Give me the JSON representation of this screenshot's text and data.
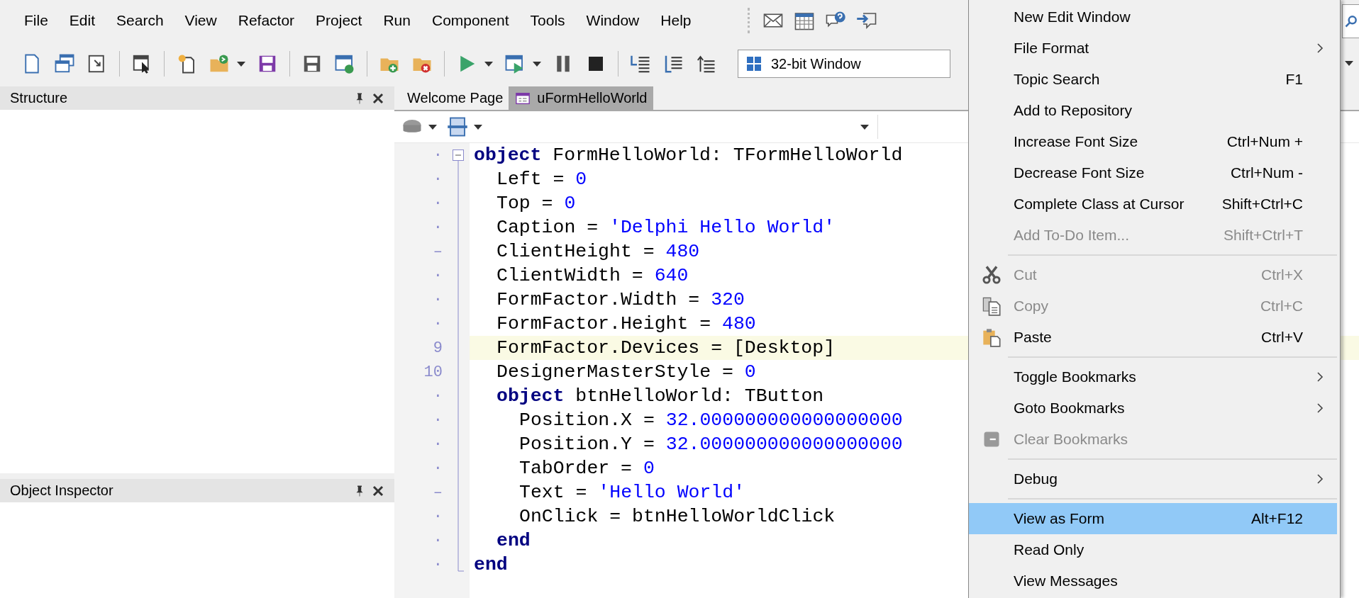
{
  "menu_bar": [
    "File",
    "Edit",
    "Search",
    "View",
    "Refactor",
    "Project",
    "Run",
    "Component",
    "Tools",
    "Window",
    "Help"
  ],
  "platform_combo": {
    "value": "32-bit Window"
  },
  "left_panels": [
    {
      "title": "Structure"
    },
    {
      "title": "Object Inspector"
    }
  ],
  "editor_tabs": [
    {
      "label": "Welcome Page",
      "selected": false
    },
    {
      "label": "uFormHelloWorld",
      "selected": true
    }
  ],
  "code_lines": [
    {
      "gutter": "·",
      "current": false,
      "tokens": [
        {
          "kind": "keyword",
          "t": "object"
        },
        {
          "kind": "plain",
          "t": " FormHelloWorld: TFormHelloWorld"
        }
      ],
      "children": [
        {
          "gutter": "·",
          "current": false,
          "tokens": [
            {
              "kind": "plain",
              "t": "Left = "
            },
            {
              "kind": "number",
              "t": "0"
            }
          ]
        },
        {
          "gutter": "·",
          "current": false,
          "tokens": [
            {
              "kind": "plain",
              "t": "Top = "
            },
            {
              "kind": "number",
              "t": "0"
            }
          ]
        },
        {
          "gutter": "·",
          "current": false,
          "tokens": [
            {
              "kind": "plain",
              "t": "Caption = "
            },
            {
              "kind": "string",
              "t": "'Delphi Hello World'"
            }
          ]
        },
        {
          "gutter": "–",
          "current": false,
          "tokens": [
            {
              "kind": "plain",
              "t": "ClientHeight = "
            },
            {
              "kind": "number",
              "t": "480"
            }
          ]
        },
        {
          "gutter": "·",
          "current": false,
          "tokens": [
            {
              "kind": "plain",
              "t": "ClientWidth = "
            },
            {
              "kind": "number",
              "t": "640"
            }
          ]
        },
        {
          "gutter": "·",
          "current": false,
          "tokens": [
            {
              "kind": "plain",
              "t": "FormFactor.Width = "
            },
            {
              "kind": "number",
              "t": "320"
            }
          ]
        },
        {
          "gutter": "·",
          "current": false,
          "tokens": [
            {
              "kind": "plain",
              "t": "FormFactor.Height = "
            },
            {
              "kind": "number",
              "t": "480"
            }
          ]
        },
        {
          "gutter": "9",
          "current": true,
          "tokens": [
            {
              "kind": "plain",
              "t": "FormFactor.Devices = [Desktop]"
            }
          ]
        },
        {
          "gutter": "10",
          "current": false,
          "tokens": [
            {
              "kind": "plain",
              "t": "DesignerMasterStyle = "
            },
            {
              "kind": "number",
              "t": "0"
            }
          ]
        },
        {
          "gutter": "·",
          "current": false,
          "tokens": [
            {
              "kind": "keyword",
              "t": "object"
            },
            {
              "kind": "plain",
              "t": " btnHelloWorld: TButton"
            }
          ],
          "children": [
            {
              "gutter": "·",
              "current": false,
              "tokens": [
                {
                  "kind": "plain",
                  "t": "Position.X = "
                },
                {
                  "kind": "number",
                  "t": "32.000000000000000000"
                }
              ]
            },
            {
              "gutter": "·",
              "current": false,
              "tokens": [
                {
                  "kind": "plain",
                  "t": "Position.Y = "
                },
                {
                  "kind": "number",
                  "t": "32.000000000000000000"
                }
              ]
            },
            {
              "gutter": "·",
              "current": false,
              "tokens": [
                {
                  "kind": "plain",
                  "t": "TabOrder = "
                },
                {
                  "kind": "number",
                  "t": "0"
                }
              ]
            },
            {
              "gutter": "–",
              "current": false,
              "tokens": [
                {
                  "kind": "plain",
                  "t": "Text = "
                },
                {
                  "kind": "string",
                  "t": "'Hello World'"
                }
              ]
            },
            {
              "gutter": "·",
              "current": false,
              "tokens": [
                {
                  "kind": "plain",
                  "t": "OnClick = btnHelloWorldClick"
                }
              ]
            }
          ]
        },
        {
          "gutter": "·",
          "current": false,
          "tokens": [
            {
              "kind": "keyword",
              "t": "end"
            }
          ]
        }
      ]
    },
    {
      "gutter": "·",
      "current": false,
      "tokens": [
        {
          "kind": "keyword",
          "t": "end"
        }
      ]
    }
  ],
  "context_menu": {
    "items": [
      {
        "kind": "item",
        "label": "New Edit Window",
        "disabled": false,
        "selected": false,
        "submenu": false
      },
      {
        "kind": "item",
        "label": "File Format",
        "disabled": false,
        "selected": false,
        "submenu": true
      },
      {
        "kind": "item",
        "label": "Topic Search",
        "shortcut": "F1",
        "disabled": false,
        "selected": false,
        "submenu": false
      },
      {
        "kind": "item",
        "label": "Add to Repository",
        "disabled": false,
        "selected": false,
        "submenu": false
      },
      {
        "kind": "item",
        "label": "Increase Font Size",
        "shortcut": "Ctrl+Num +",
        "disabled": false,
        "selected": false,
        "submenu": false
      },
      {
        "kind": "item",
        "label": "Decrease Font Size",
        "shortcut": "Ctrl+Num -",
        "disabled": false,
        "selected": false,
        "submenu": false
      },
      {
        "kind": "item",
        "label": "Complete Class at Cursor",
        "shortcut": "Shift+Ctrl+C",
        "disabled": false,
        "selected": false,
        "submenu": false
      },
      {
        "kind": "item",
        "label": "Add To-Do Item...",
        "shortcut": "Shift+Ctrl+T",
        "disabled": true,
        "selected": false,
        "submenu": false
      },
      {
        "kind": "separator"
      },
      {
        "kind": "item",
        "label": "Cut",
        "shortcut": "Ctrl+X",
        "disabled": true,
        "selected": false,
        "submenu": false
      },
      {
        "kind": "item",
        "label": "Copy",
        "shortcut": "Ctrl+C",
        "disabled": true,
        "selected": false,
        "submenu": false
      },
      {
        "kind": "item",
        "label": "Paste",
        "shortcut": "Ctrl+V",
        "disabled": false,
        "selected": false,
        "submenu": false
      },
      {
        "kind": "separator"
      },
      {
        "kind": "item",
        "label": "Toggle Bookmarks",
        "disabled": false,
        "selected": false,
        "submenu": true
      },
      {
        "kind": "item",
        "label": "Goto Bookmarks",
        "disabled": false,
        "selected": false,
        "submenu": true
      },
      {
        "kind": "item",
        "label": "Clear Bookmarks",
        "disabled": true,
        "selected": false,
        "submenu": false
      },
      {
        "kind": "separator"
      },
      {
        "kind": "item",
        "label": "Debug",
        "disabled": false,
        "selected": false,
        "submenu": true
      },
      {
        "kind": "separator"
      },
      {
        "kind": "item",
        "label": "View as Form",
        "shortcut": "Alt+F12",
        "disabled": false,
        "selected": true,
        "submenu": false
      },
      {
        "kind": "item",
        "label": "Read Only",
        "disabled": false,
        "selected": false,
        "submenu": false
      },
      {
        "kind": "item",
        "label": "View Messages",
        "disabled": false,
        "selected": false,
        "submenu": false
      }
    ]
  }
}
